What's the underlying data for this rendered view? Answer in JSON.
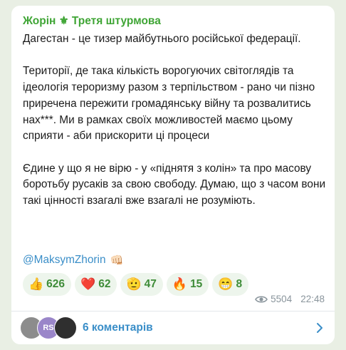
{
  "post": {
    "author": "Жорін ⚜ Третя штурмова",
    "paragraphs": [
      "Дагестан  - це тизер майбутнього російської федерації.",
      "Території, де така кількість ворогуючих світоглядів та ідеологія тероризму разом з терпільством - рано чи пізно приречена пережити громадянську війну та розвалитись нах***. Ми в рамках своїх можливостей маємо цьому сприяти - аби прискорити ці процеси",
      "Єдине у що я не вірю - у «пiднятя з колiн» та про масову боротьбу русаків за свою свободу. Думаю, що з часом вони такі цінності взагалі вже взагалі не розуміють."
    ],
    "handle": "@MaksymZhorin",
    "handle_emoji": "👊🏻"
  },
  "reactions": [
    {
      "emoji": "👍",
      "count": "626"
    },
    {
      "emoji": "❤️",
      "count": "62"
    },
    {
      "emoji": "🫡",
      "count": "47"
    },
    {
      "emoji": "🔥",
      "count": "15"
    },
    {
      "emoji": "😁",
      "count": "8"
    }
  ],
  "meta": {
    "views": "5504",
    "time": "22:48"
  },
  "comments": {
    "label": "6 коментарів",
    "avatar_initials": [
      "",
      "RS",
      ""
    ]
  },
  "colors": {
    "author": "#3fa535",
    "link": "#3a8ec8",
    "reaction_bg": "#edf5ec",
    "reaction_text": "#3e8c38",
    "background": "#e9efe4"
  }
}
